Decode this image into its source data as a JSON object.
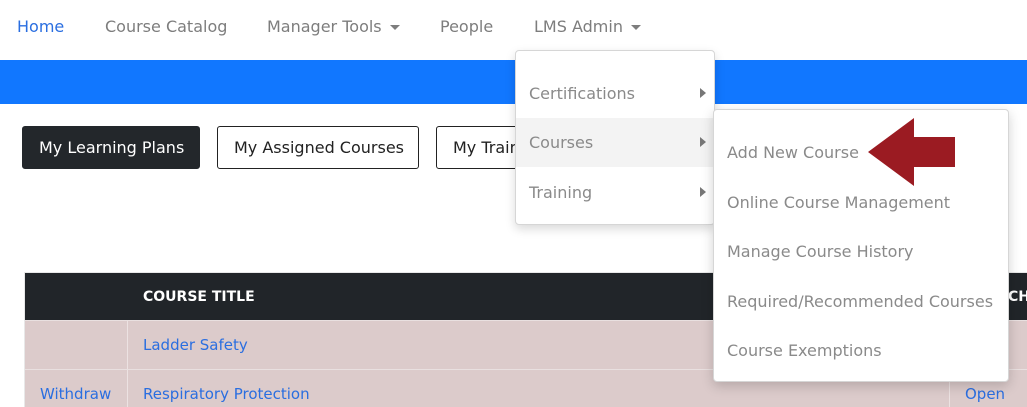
{
  "nav": {
    "home": "Home",
    "course_catalog": "Course Catalog",
    "manager_tools": "Manager Tools",
    "people": "People",
    "lms_admin": "LMS Admin"
  },
  "buttons": {
    "my_learning_plans": "My Learning Plans",
    "my_assigned_courses": "My Assigned Courses",
    "my_training": "My Training"
  },
  "table": {
    "header_course_title": "COURSE TITLE",
    "header_right_partial": "CH/",
    "rows": [
      {
        "action": "",
        "title": "Ladder Safety",
        "right": ""
      },
      {
        "action": "Withdraw",
        "title": "Respiratory Protection",
        "right": "Open"
      }
    ]
  },
  "lms_admin_menu": {
    "items": [
      "Certifications",
      "Courses",
      "Training"
    ]
  },
  "courses_submenu": {
    "items": [
      "Add New Course",
      "Online Course Management",
      "Manage Course History",
      "Required/Recommended Courses",
      "Course Exemptions"
    ]
  },
  "colors": {
    "primary_blue": "#1177ff",
    "link_blue": "#2a6ee0",
    "header_dark": "#212529",
    "row_pink": "#dccbcb",
    "arrow_red": "#9b1b22"
  }
}
